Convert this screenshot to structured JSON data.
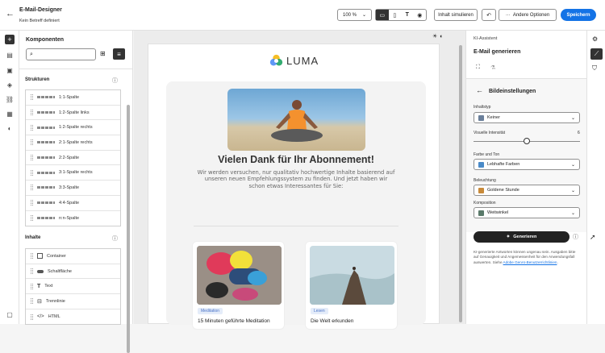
{
  "header": {
    "title": "E-Mail-Designer",
    "subtitle": "Kein Betreff definiert",
    "zoom": "100 %",
    "simulate_label": "Inhalt simulieren",
    "more_label": "Andere Optionen",
    "save_label": "Speichern"
  },
  "components": {
    "title": "Komponenten",
    "search_placeholder": "",
    "structures_title": "Strukturen",
    "structures": [
      "1:1-Spalte",
      "1:2-Spalte links",
      "1:2-Spalte rechts",
      "2:1-Spalte rechts",
      "2:2-Spalte",
      "3:1-Spalte rechts",
      "3:3-Spalte",
      "4:4-Spalte",
      "n:n-Spalte"
    ],
    "contents_title": "Inhalte",
    "contents": [
      "Container",
      "Schaltfläche",
      "Text",
      "Trennlinie",
      "HTML"
    ]
  },
  "email": {
    "brand": "LUMA",
    "headline": "Vielen Dank für Ihr Abonnement!",
    "body": "Wir werden versuchen, nur qualitativ hochwertige Inhalte basierend auf unseren neuen Empfehlungssystem zu finden. Und jetzt haben wir schon etwas Interessantes für Sie:",
    "cards": [
      {
        "tag": "Meditation",
        "title": "15 Minuten geführte Meditation"
      },
      {
        "tag": "Lesen",
        "title": "Die Welt erkunden"
      }
    ]
  },
  "assistant": {
    "panel_label": "KI-Assistent",
    "title": "E-Mail generieren",
    "section_title": "Bildeinstellungen",
    "content_type_label": "Inhaltstyp",
    "content_type_value": "Keiner",
    "visual_intensity_label": "Visuelle Intensität",
    "visual_intensity_value": "6",
    "color_label": "Farbe und Ton",
    "color_value": "Lebhafte Farben",
    "lighting_label": "Beleuchtung",
    "lighting_value": "Goldene Stunde",
    "composition_label": "Komposition",
    "composition_value": "Weitwinkel",
    "generate_label": "Generieren",
    "disclaimer_pre": "KI-generierte Antworten können ungenau sein. Ausgaben bitte auf Genauigkeit und Angemessenheit für den Anwendungsfall auswerten. Siehe ",
    "disclaimer_link": "Adobe GenAI-Benutzerrichtlinien",
    "disclaimer_post": "."
  }
}
